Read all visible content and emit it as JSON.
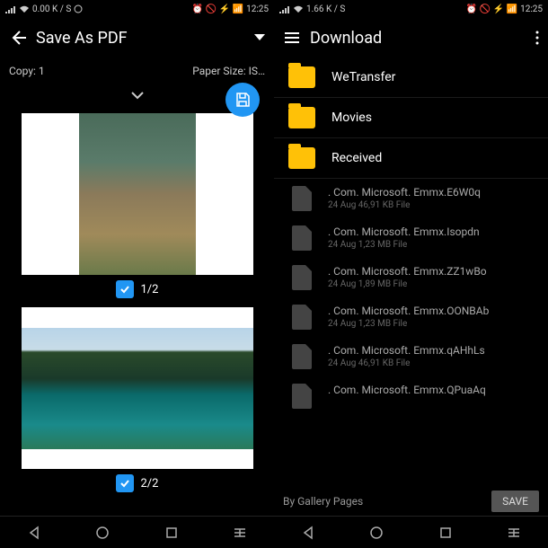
{
  "left": {
    "status": {
      "net": "0.00 K / S",
      "time": "12:25"
    },
    "title": "Save As PDF",
    "copy_label": "Copy: 1",
    "paper_label": "Paper Size: IS…",
    "pages": [
      {
        "label": "1/2"
      },
      {
        "label": "2/2"
      }
    ]
  },
  "right": {
    "status": {
      "net": "1.66 K / S",
      "time": "12:25"
    },
    "title": "Download",
    "folders": [
      {
        "name": "WeTransfer"
      },
      {
        "name": "Movies"
      },
      {
        "name": "Received"
      }
    ],
    "files": [
      {
        "name": ". Com. Microsoft. Emmx.E6W0q",
        "meta": "24 Aug 46,91 KB File"
      },
      {
        "name": ". Com. Microsoft. Emmx.Isopdn",
        "meta": "24 Aug 1,23 MB File"
      },
      {
        "name": ". Com. Microsoft. Emmx.ZZ1wBo",
        "meta": "24 Aug 1,89 MB File"
      },
      {
        "name": ". Com. Microsoft. Emmx.OONBAb",
        "meta": "24 Aug 1,23 MB File"
      },
      {
        "name": ". Com. Microsoft. Emmx.qAHhLs",
        "meta": "24 Aug 46,91 KB File"
      },
      {
        "name": ". Com. Microsoft. Emmx.QPuaAq",
        "meta": ""
      }
    ],
    "source": "By Gallery Pages",
    "save_label": "SAVE"
  }
}
